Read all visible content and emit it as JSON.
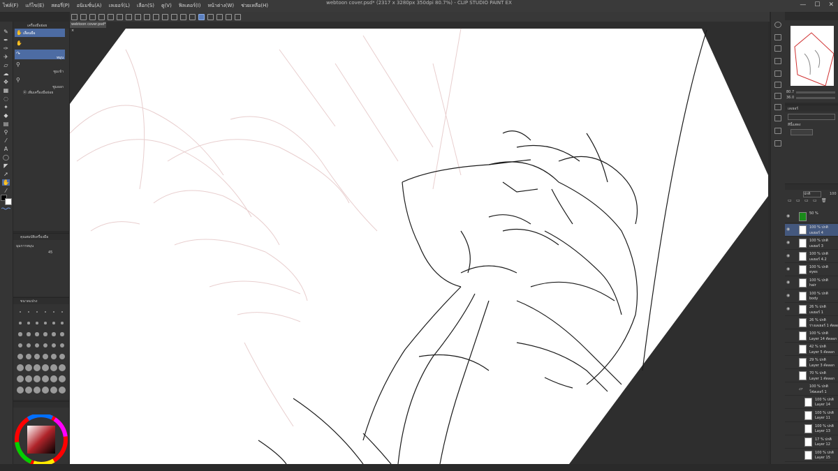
{
  "window": {
    "title": "webtoon cover.psd* (2317 x 3280px 350dpi 80.7%) - CLIP STUDIO PAINT EX",
    "menus": [
      "ไฟล์(F)",
      "แก้ไข(E)",
      "สตอรี่(P)",
      "อนิเมชั่น(A)",
      "เลเยอร์(L)",
      "เลือก(S)",
      "ดู(V)",
      "ฟิลเตอร์(I)",
      "หน้าต่าง(W)",
      "ช่วยเหลือ(H)"
    ],
    "controls": [
      "—",
      "☐",
      "✕"
    ]
  },
  "document_tab": {
    "label": "webtoon cover.psd*",
    "close": "×"
  },
  "toolbar": {
    "tools": [
      "pencil",
      "pen",
      "brush",
      "airbrush",
      "eraser",
      "fill",
      "move",
      "gradient",
      "text",
      "lasso",
      "eyedropper",
      "hand"
    ],
    "active_tool": "hand"
  },
  "subtool": {
    "group_title": "เครื่องมือย่อย",
    "items": [
      {
        "label": "เลื่อนมือ",
        "sub": "",
        "selected": true
      },
      {
        "label": "",
        "sub": "หมุน",
        "selected": false
      },
      {
        "label": "",
        "sub": "ซูมเข้า",
        "selected": false
      },
      {
        "label": "",
        "sub": "ซูมออก",
        "selected": false
      }
    ],
    "add_label": "เพิ่มเครื่องมือย่อย"
  },
  "tool_property": {
    "title": "คุณสมบัติเครื่องมือ",
    "field_label": "มุมการหมุน",
    "value": "45"
  },
  "brush_size": {
    "title": "ขนาดแปรง"
  },
  "colors": {
    "main": "#000000",
    "sub": "#ffffff",
    "accent": "#4f6ea8"
  },
  "navigator": {
    "zoom": "80.7",
    "rotation": "36.0"
  },
  "sub_view": {
    "title": "เลเยอร์",
    "label": "สีนี้แสดง"
  },
  "layer_panel": {
    "blend": "ปกติ",
    "opacity": "100",
    "layers": [
      {
        "opacity": "50 %",
        "name": "",
        "selected": false,
        "visible": true,
        "thumb": "#1a8a1a"
      },
      {
        "opacity": "100 % ปกติ",
        "name": "เลเยอร์ 4",
        "selected": true,
        "visible": true,
        "thumb": "#ffffff"
      },
      {
        "opacity": "100 % ปกติ",
        "name": "เลเยอร์ 3",
        "selected": false,
        "visible": true,
        "thumb": "#ffffff"
      },
      {
        "opacity": "100 % ปกติ",
        "name": "เลเยอร์ 4.2",
        "selected": false,
        "visible": true,
        "thumb": "#ffffff"
      },
      {
        "opacity": "100 % ปกติ",
        "name": "eyes",
        "selected": false,
        "visible": true,
        "thumb": "#ffffff"
      },
      {
        "opacity": "100 % ปกติ",
        "name": "hair",
        "selected": false,
        "visible": true,
        "thumb": "#ffffff"
      },
      {
        "opacity": "100 % ปกติ",
        "name": "body",
        "selected": false,
        "visible": true,
        "thumb": "#ffffff"
      },
      {
        "opacity": "26 % ปกติ",
        "name": "เลเยอร์ 1",
        "selected": false,
        "visible": true,
        "thumb": "#ffffff"
      },
      {
        "opacity": "26 % ปกติ",
        "name": "ร่างเลเยอร์ 1 คัดลอก",
        "selected": false,
        "visible": false,
        "thumb": "#ffffff"
      },
      {
        "opacity": "100 % ปกติ",
        "name": "Layer 14 คัดลอก",
        "selected": false,
        "visible": false,
        "thumb": "#ffffff"
      },
      {
        "opacity": "42 % ปกติ",
        "name": "Layer 5 คัดลอก",
        "selected": false,
        "visible": false,
        "thumb": "#ffffff"
      },
      {
        "opacity": "29 % ปกติ",
        "name": "Layer 3 คัดลอก",
        "selected": false,
        "visible": false,
        "thumb": "#ffffff"
      },
      {
        "opacity": "70 % ปกติ",
        "name": "Layer 1 คัดลอก",
        "selected": false,
        "visible": false,
        "thumb": "#ffffff"
      }
    ],
    "folder": {
      "opacity": "100 % ปกติ",
      "name": "โฟลเดอร์ 1"
    },
    "folder_layers": [
      {
        "opacity": "100 % ปกติ",
        "name": "Layer 14"
      },
      {
        "opacity": "100 % ปกติ",
        "name": "Layer 11"
      },
      {
        "opacity": "100 % ปกติ",
        "name": "Layer 13"
      },
      {
        "opacity": "17 % ปกติ",
        "name": "Layer 12"
      },
      {
        "opacity": "100 % ปกติ",
        "name": "Layer 15"
      }
    ]
  }
}
